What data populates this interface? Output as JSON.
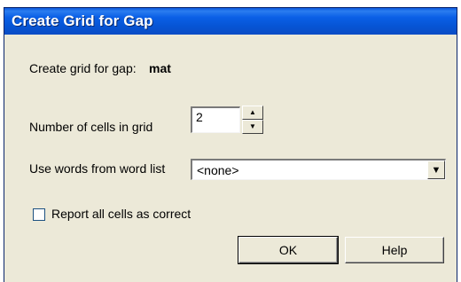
{
  "window": {
    "title": "Create Grid for Gap"
  },
  "gap": {
    "label": "Create grid for gap:",
    "name": "mat"
  },
  "cells": {
    "label": "Number of cells in grid",
    "value": "2",
    "up_glyph": "▲",
    "down_glyph": "▼"
  },
  "wordlist": {
    "label": "Use words from word list",
    "selected": "<none>",
    "arrow": "▼"
  },
  "report": {
    "label": "Report all cells as correct",
    "checked": false
  },
  "buttons": {
    "ok": "OK",
    "help": "Help"
  }
}
